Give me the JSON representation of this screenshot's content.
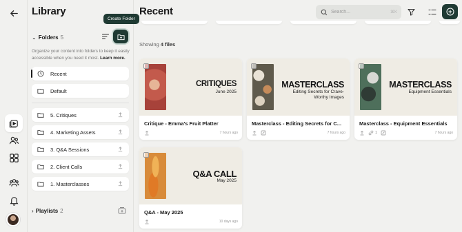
{
  "rail": {
    "icons": [
      "back-arrow-icon",
      "library-icon",
      "contacts-icon",
      "grid-icon",
      "team-icon",
      "notifications-icon"
    ]
  },
  "library": {
    "title": "Library",
    "folders_label": "Folders",
    "folders_count": "5",
    "tooltip": "Create Folder",
    "help_text": "Organize your content into folders to keep it easily accessible when you need it most.",
    "help_link": "Learn more.",
    "pinned": [
      {
        "label": "Recent",
        "icon": "clock-icon"
      },
      {
        "label": "Default",
        "icon": "folder-icon"
      }
    ],
    "folders": [
      {
        "label": "5. Critiques"
      },
      {
        "label": "4. Marketing Assets"
      },
      {
        "label": "3. Q&A Sessions"
      },
      {
        "label": "2. Client Calls"
      },
      {
        "label": "1. Masterclasses"
      }
    ],
    "playlists_label": "Playlists",
    "playlists_count": "2"
  },
  "main": {
    "title": "Recent",
    "search_placeholder": "Search...",
    "search_shortcut": "⌘K",
    "showing_prefix": "Showing",
    "showing_count": "4 files",
    "cards": [
      {
        "title": "Critique - Emma's Fruit Platter",
        "thumb_big": "CRITIQUES",
        "thumb_sub": "June 2025",
        "time": "7 hours ago",
        "photo_color": "#c35a4c"
      },
      {
        "title": "Masterclass - Editing Secrets for C...",
        "thumb_big": "MASTERCLASS",
        "thumb_sub": "Editing Secrets for Crave-Worthy Images",
        "time": "7 hours ago",
        "photo_color": "#6f6a5a"
      },
      {
        "title": "Masterclass - Equipment Essentials",
        "thumb_big": "MASTERCLASS",
        "thumb_sub": "Equipment Essentials",
        "time": "7 hours ago",
        "link_count": "1",
        "photo_color": "#4e6f5b"
      },
      {
        "title": "Q&A - May 2025",
        "thumb_big": "Q&A CALL",
        "thumb_sub": "May 2025",
        "time": "10 days ago",
        "photo_color": "#e38a2a"
      }
    ]
  },
  "colors": {
    "accent": "#1f3a33",
    "background": "#f1f1ef",
    "card": "#ffffff"
  }
}
